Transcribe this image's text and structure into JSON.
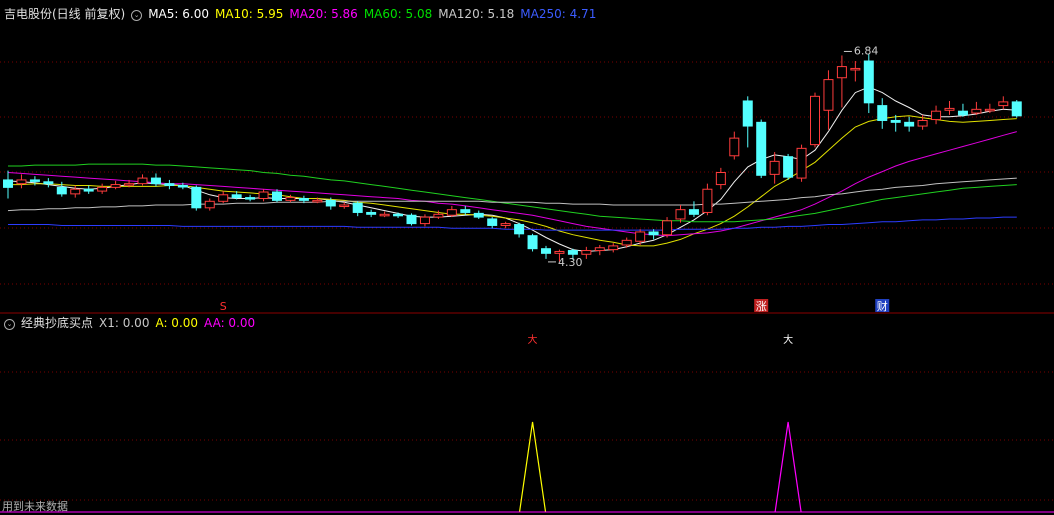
{
  "main_panel": {
    "title": "吉电股份(日线 前复权)",
    "indicators": [
      {
        "label": "MA5: 6.00",
        "color": "#ffffff"
      },
      {
        "label": "MA10: 5.95",
        "color": "#ffff00"
      },
      {
        "label": "MA20: 5.86",
        "color": "#ff00ff"
      },
      {
        "label": "MA60: 5.08",
        "color": "#00e000"
      },
      {
        "label": "MA120: 5.18",
        "color": "#c8c8c8"
      },
      {
        "label": "MA250: 4.71",
        "color": "#3c5cff"
      }
    ],
    "high_label": "6.84",
    "low_label": "4.30",
    "markers": [
      {
        "text": "S",
        "color": "#ff3030"
      },
      {
        "text": "涨",
        "color": "#ffffff",
        "bg": "#c02020"
      },
      {
        "text": "财",
        "color": "#ffffff",
        "bg": "#2040c0"
      }
    ]
  },
  "sub_panel": {
    "title": "经典抄底买点",
    "indicators": [
      {
        "label": "X1: 0.00",
        "color": "#c8c8c8"
      },
      {
        "label": "A: 0.00",
        "color": "#ffff00"
      },
      {
        "label": "AA: 0.00",
        "color": "#ff00ff"
      }
    ],
    "signal_marks": [
      {
        "text": "大",
        "color": "#ff3030"
      },
      {
        "text": "大",
        "color": "#ffffff"
      }
    ],
    "footnote": "用到未来数据"
  },
  "chart_data": {
    "type": "candlestick",
    "price_range": [
      4.1,
      7.2
    ],
    "candles": [
      [
        5.5,
        5.42,
        5.6,
        5.3
      ],
      [
        5.46,
        5.5,
        5.56,
        5.41
      ],
      [
        5.5,
        5.49,
        5.54,
        5.44
      ],
      [
        5.48,
        5.46,
        5.52,
        5.42
      ],
      [
        5.42,
        5.35,
        5.48,
        5.32
      ],
      [
        5.35,
        5.4,
        5.44,
        5.31
      ],
      [
        5.4,
        5.38,
        5.44,
        5.35
      ],
      [
        5.38,
        5.42,
        5.46,
        5.35
      ],
      [
        5.42,
        5.45,
        5.49,
        5.4
      ],
      [
        5.45,
        5.46,
        5.5,
        5.42
      ],
      [
        5.46,
        5.52,
        5.56,
        5.44
      ],
      [
        5.52,
        5.46,
        5.57,
        5.43
      ],
      [
        5.46,
        5.44,
        5.5,
        5.4
      ],
      [
        5.44,
        5.43,
        5.47,
        5.4
      ],
      [
        5.42,
        5.2,
        5.44,
        5.17
      ],
      [
        5.2,
        5.27,
        5.3,
        5.17
      ],
      [
        5.27,
        5.34,
        5.38,
        5.25
      ],
      [
        5.34,
        5.31,
        5.38,
        5.29
      ],
      [
        5.31,
        5.3,
        5.34,
        5.27
      ],
      [
        5.3,
        5.37,
        5.4,
        5.27
      ],
      [
        5.37,
        5.28,
        5.4,
        5.26
      ],
      [
        5.28,
        5.31,
        5.34,
        5.26
      ],
      [
        5.3,
        5.28,
        5.33,
        5.25
      ],
      [
        5.28,
        5.28,
        5.31,
        5.25
      ],
      [
        5.28,
        5.22,
        5.31,
        5.18
      ],
      [
        5.22,
        5.23,
        5.26,
        5.19
      ],
      [
        5.25,
        5.15,
        5.27,
        5.11
      ],
      [
        5.15,
        5.13,
        5.18,
        5.1
      ],
      [
        5.13,
        5.13,
        5.16,
        5.1
      ],
      [
        5.13,
        5.12,
        5.15,
        5.09
      ],
      [
        5.12,
        5.03,
        5.14,
        5.01
      ],
      [
        5.03,
        5.1,
        5.13,
        5.0
      ],
      [
        5.1,
        5.13,
        5.17,
        5.08
      ],
      [
        5.12,
        5.18,
        5.22,
        5.1
      ],
      [
        5.18,
        5.15,
        5.22,
        5.12
      ],
      [
        5.14,
        5.1,
        5.17,
        5.08
      ],
      [
        5.08,
        5.01,
        5.1,
        4.98
      ],
      [
        5.01,
        5.03,
        5.05,
        4.98
      ],
      [
        5.02,
        4.92,
        5.04,
        4.88
      ],
      [
        4.9,
        4.76,
        4.92,
        4.73
      ],
      [
        4.76,
        4.71,
        4.79,
        4.65
      ],
      [
        4.71,
        4.73,
        4.75,
        4.62
      ],
      [
        4.74,
        4.7,
        4.76,
        4.64
      ],
      [
        4.7,
        4.74,
        4.78,
        4.65
      ],
      [
        4.74,
        4.77,
        4.8,
        4.69
      ],
      [
        4.75,
        4.79,
        4.82,
        4.72
      ],
      [
        4.8,
        4.85,
        4.88,
        4.77
      ],
      [
        4.84,
        4.94,
        4.97,
        4.8
      ],
      [
        4.94,
        4.91,
        4.97,
        4.86
      ],
      [
        4.91,
        5.06,
        5.1,
        4.88
      ],
      [
        5.08,
        5.18,
        5.23,
        5.04
      ],
      [
        5.18,
        5.13,
        5.27,
        5.1
      ],
      [
        5.15,
        5.4,
        5.46,
        5.12
      ],
      [
        5.45,
        5.58,
        5.63,
        5.4
      ],
      [
        5.76,
        5.95,
        6.02,
        5.72
      ],
      [
        6.35,
        6.08,
        6.4,
        5.85
      ],
      [
        6.12,
        5.55,
        6.15,
        5.52
      ],
      [
        5.56,
        5.7,
        5.8,
        5.46
      ],
      [
        5.75,
        5.53,
        5.78,
        5.5
      ],
      [
        5.52,
        5.84,
        5.88,
        5.48
      ],
      [
        5.88,
        6.4,
        6.44,
        5.85
      ],
      [
        6.25,
        6.58,
        6.68,
        6.04
      ],
      [
        6.6,
        6.72,
        6.84,
        6.28
      ],
      [
        6.7,
        6.7,
        6.78,
        6.56
      ],
      [
        6.78,
        6.33,
        6.86,
        6.22
      ],
      [
        6.3,
        6.14,
        6.38,
        6.05
      ],
      [
        6.14,
        6.12,
        6.2,
        6.02
      ],
      [
        6.12,
        6.08,
        6.18,
        6.02
      ],
      [
        6.08,
        6.14,
        6.2,
        6.04
      ],
      [
        6.15,
        6.24,
        6.3,
        6.1
      ],
      [
        6.25,
        6.27,
        6.35,
        6.2
      ],
      [
        6.24,
        6.2,
        6.32,
        6.18
      ],
      [
        6.22,
        6.26,
        6.34,
        6.2
      ],
      [
        6.26,
        6.26,
        6.32,
        6.22
      ],
      [
        6.3,
        6.34,
        6.4,
        6.26
      ],
      [
        6.34,
        6.19,
        6.36,
        6.17
      ]
    ],
    "ma": [
      {
        "name": "MA5",
        "color": "#f0f0f0",
        "values": [
          5.49,
          5.48,
          5.47,
          5.45,
          5.43,
          5.41,
          5.4,
          5.41,
          5.43,
          5.45,
          5.47,
          5.46,
          5.45,
          5.44,
          5.39,
          5.34,
          5.31,
          5.3,
          5.3,
          5.31,
          5.3,
          5.3,
          5.3,
          5.3,
          5.28,
          5.26,
          5.23,
          5.2,
          5.17,
          5.14,
          5.11,
          5.1,
          5.1,
          5.11,
          5.12,
          5.13,
          5.12,
          5.09,
          5.03,
          4.96,
          4.88,
          4.81,
          4.75,
          4.73,
          4.74,
          4.75,
          4.78,
          4.82,
          4.85,
          4.91,
          4.99,
          5.07,
          5.17,
          5.29,
          5.48,
          5.64,
          5.72,
          5.77,
          5.75,
          5.72,
          5.82,
          6.02,
          6.25,
          6.44,
          6.5,
          6.44,
          6.35,
          6.28,
          6.2,
          6.18,
          6.18,
          6.19,
          6.21,
          6.24,
          6.26,
          6.25
        ]
      },
      {
        "name": "MA10",
        "color": "#e0e000",
        "values": [
          5.45,
          5.45,
          5.46,
          5.46,
          5.45,
          5.44,
          5.44,
          5.43,
          5.43,
          5.43,
          5.43,
          5.43,
          5.44,
          5.44,
          5.42,
          5.4,
          5.38,
          5.37,
          5.36,
          5.35,
          5.34,
          5.32,
          5.3,
          5.3,
          5.29,
          5.28,
          5.26,
          5.25,
          5.23,
          5.21,
          5.19,
          5.17,
          5.15,
          5.13,
          5.13,
          5.12,
          5.11,
          5.09,
          5.07,
          5.04,
          5.0,
          4.95,
          4.91,
          4.88,
          4.85,
          4.83,
          4.8,
          4.79,
          4.79,
          4.82,
          4.86,
          4.92,
          4.97,
          5.03,
          5.11,
          5.21,
          5.32,
          5.43,
          5.51,
          5.6,
          5.69,
          5.82,
          5.95,
          6.07,
          6.13,
          6.16,
          6.18,
          6.19,
          6.17,
          6.15,
          6.13,
          6.12,
          6.13,
          6.14,
          6.15,
          6.16
        ]
      },
      {
        "name": "MA20",
        "color": "#e000e0",
        "values": [
          5.58,
          5.57,
          5.56,
          5.55,
          5.54,
          5.53,
          5.52,
          5.51,
          5.5,
          5.49,
          5.48,
          5.47,
          5.46,
          5.46,
          5.45,
          5.44,
          5.43,
          5.42,
          5.41,
          5.4,
          5.39,
          5.38,
          5.37,
          5.36,
          5.35,
          5.34,
          5.33,
          5.32,
          5.31,
          5.3,
          5.28,
          5.27,
          5.25,
          5.24,
          5.22,
          5.2,
          5.18,
          5.16,
          5.14,
          5.12,
          5.09,
          5.06,
          5.03,
          5.0,
          4.98,
          4.96,
          4.94,
          4.92,
          4.91,
          4.9,
          4.91,
          4.92,
          4.93,
          4.95,
          4.98,
          5.02,
          5.06,
          5.1,
          5.14,
          5.18,
          5.24,
          5.31,
          5.38,
          5.46,
          5.53,
          5.59,
          5.65,
          5.7,
          5.74,
          5.78,
          5.82,
          5.86,
          5.9,
          5.94,
          5.98,
          6.02
        ]
      },
      {
        "name": "MA60",
        "color": "#20d020",
        "values": [
          5.65,
          5.65,
          5.66,
          5.66,
          5.66,
          5.66,
          5.67,
          5.67,
          5.67,
          5.67,
          5.67,
          5.66,
          5.66,
          5.65,
          5.64,
          5.63,
          5.62,
          5.61,
          5.6,
          5.58,
          5.57,
          5.55,
          5.54,
          5.52,
          5.5,
          5.49,
          5.47,
          5.45,
          5.43,
          5.41,
          5.39,
          5.37,
          5.35,
          5.33,
          5.31,
          5.29,
          5.27,
          5.25,
          5.23,
          5.21,
          5.19,
          5.17,
          5.15,
          5.13,
          5.11,
          5.1,
          5.09,
          5.08,
          5.07,
          5.06,
          5.06,
          5.05,
          5.05,
          5.05,
          5.05,
          5.06,
          5.07,
          5.08,
          5.1,
          5.12,
          5.14,
          5.17,
          5.2,
          5.23,
          5.26,
          5.29,
          5.31,
          5.33,
          5.35,
          5.37,
          5.39,
          5.41,
          5.42,
          5.43,
          5.44,
          5.45
        ]
      },
      {
        "name": "MA120",
        "color": "#c0c0c0",
        "values": [
          5.17,
          5.18,
          5.18,
          5.19,
          5.19,
          5.2,
          5.2,
          5.21,
          5.21,
          5.22,
          5.22,
          5.23,
          5.23,
          5.23,
          5.24,
          5.24,
          5.24,
          5.25,
          5.25,
          5.25,
          5.26,
          5.26,
          5.26,
          5.26,
          5.27,
          5.27,
          5.27,
          5.27,
          5.27,
          5.27,
          5.27,
          5.27,
          5.27,
          5.27,
          5.27,
          5.27,
          5.26,
          5.26,
          5.26,
          5.26,
          5.25,
          5.25,
          5.24,
          5.24,
          5.24,
          5.23,
          5.23,
          5.23,
          5.23,
          5.23,
          5.23,
          5.23,
          5.24,
          5.24,
          5.25,
          5.26,
          5.27,
          5.28,
          5.29,
          5.31,
          5.32,
          5.34,
          5.35,
          5.37,
          5.39,
          5.4,
          5.42,
          5.43,
          5.44,
          5.46,
          5.47,
          5.48,
          5.49,
          5.5,
          5.51,
          5.52
        ]
      },
      {
        "name": "MA250",
        "color": "#2c3cff",
        "values": [
          5.02,
          5.02,
          5.02,
          5.02,
          5.01,
          5.01,
          5.01,
          5.01,
          5.01,
          5.01,
          5.01,
          5.01,
          5.01,
          5.0,
          5.0,
          5.0,
          5.0,
          5.0,
          5.0,
          5.0,
          5.0,
          5.0,
          5.0,
          5.0,
          5.0,
          5.0,
          4.99,
          4.99,
          4.99,
          4.99,
          4.99,
          4.99,
          4.99,
          4.98,
          4.98,
          4.98,
          4.98,
          4.97,
          4.97,
          4.97,
          4.96,
          4.96,
          4.96,
          4.96,
          4.96,
          4.96,
          4.96,
          4.96,
          4.96,
          4.96,
          4.97,
          4.97,
          4.97,
          4.97,
          4.98,
          4.98,
          4.99,
          4.99,
          5.0,
          5.0,
          5.01,
          5.02,
          5.02,
          5.03,
          5.04,
          5.05,
          5.05,
          5.06,
          5.07,
          5.07,
          5.08,
          5.08,
          5.09,
          5.09,
          5.1,
          5.1
        ]
      }
    ],
    "low_index": 40,
    "high_index": 62,
    "signal_peaks": [
      {
        "index": 39,
        "color": "#ffff00"
      },
      {
        "index": 58,
        "color": "#ff00ff"
      }
    ],
    "marker_index": [
      16,
      56,
      65
    ]
  }
}
